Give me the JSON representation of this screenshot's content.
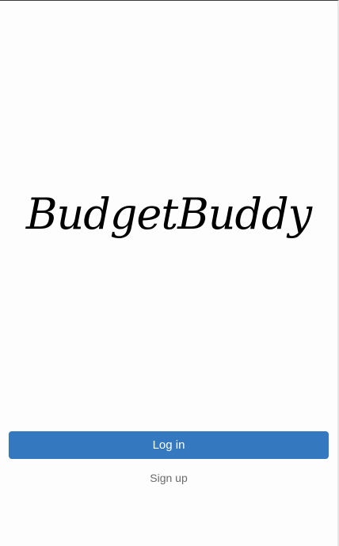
{
  "app": {
    "logo_text": "BudgetBuddy"
  },
  "actions": {
    "login_label": "Log in",
    "signup_label": "Sign up"
  },
  "colors": {
    "primary": "#3478c0",
    "background": "#fdfdfd",
    "link_text": "#6b6b6b"
  }
}
